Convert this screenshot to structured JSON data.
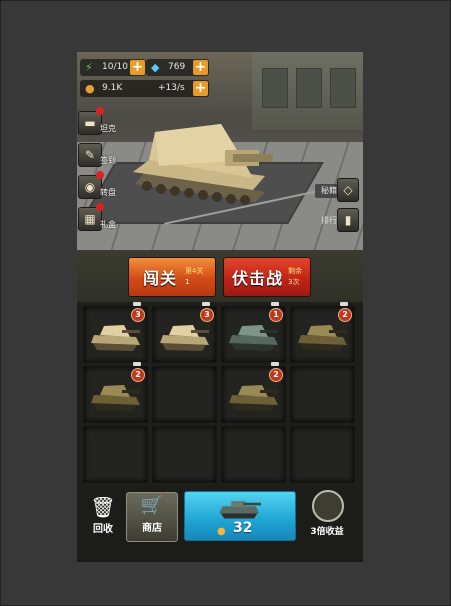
{
  "stats": {
    "energy": "10/10",
    "gems": "769",
    "coins": "9.1K",
    "income": "+13/s"
  },
  "side_menu": [
    {
      "label": "坦克",
      "icon": "tank-icon"
    },
    {
      "label": "签到",
      "icon": "checkin-icon"
    },
    {
      "label": "转盘",
      "icon": "wheel-icon"
    },
    {
      "label": "礼盒",
      "icon": "gift-icon"
    }
  ],
  "right_menu": [
    {
      "label": "秘籍",
      "icon": "diamond-icon"
    },
    {
      "label": "排行",
      "icon": "ranking-icon"
    }
  ],
  "battle": {
    "stage_label": "闯关",
    "stage_num": "第4关",
    "stage_star": "1",
    "ambush_label": "伏击战",
    "ambush_remain_label": "剩余",
    "ambush_remain": "3次"
  },
  "grid": {
    "slots": [
      {
        "tank": "sand-artillery",
        "level": "3"
      },
      {
        "tank": "sand-artillery",
        "level": "3"
      },
      {
        "tank": "grey-tank",
        "level": "1"
      },
      {
        "tank": "camo-tank",
        "level": "2"
      },
      {
        "tank": "camo-tank",
        "level": "2"
      },
      {
        "tank": null,
        "level": ""
      },
      {
        "tank": "camo-tank",
        "level": "2"
      },
      {
        "tank": null,
        "level": ""
      },
      {
        "tank": null,
        "level": ""
      },
      {
        "tank": null,
        "level": ""
      },
      {
        "tank": null,
        "level": ""
      },
      {
        "tank": null,
        "level": ""
      }
    ]
  },
  "bottom": {
    "recycle_label": "回收",
    "shop_label": "商店",
    "buy_cost": "32",
    "boost_label": "3倍收益"
  },
  "colors": {
    "accent_orange": "#e89a2a",
    "stage_button": "#d24b16",
    "ambush_button": "#c02418",
    "buy_button": "#1fa4d4",
    "level_badge": "#c2361e"
  }
}
